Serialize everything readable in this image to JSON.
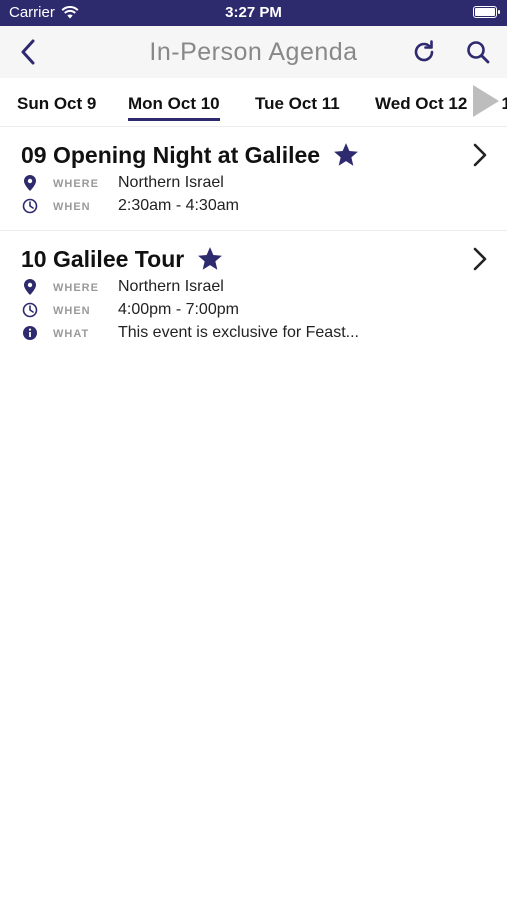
{
  "status_bar": {
    "carrier": "Carrier",
    "time": "3:27 PM"
  },
  "nav": {
    "title": "In-Person Agenda",
    "back_icon": "chevron-left-icon",
    "refresh_icon": "refresh-icon",
    "search_icon": "search-icon"
  },
  "tabs": [
    {
      "label": "Sun Oct 9"
    },
    {
      "label": "Mon Oct 10",
      "active": true
    },
    {
      "label": "Tue Oct 11"
    },
    {
      "label": "Wed Oct 12"
    },
    {
      "label": "1"
    }
  ],
  "events": [
    {
      "title": "09 Opening Night at Galilee",
      "favorited": true,
      "where_label": "WHERE",
      "where": "Northern Israel",
      "when_label": "WHEN",
      "when": "2:30am - 4:30am"
    },
    {
      "title": "10 Galilee Tour",
      "favorited": true,
      "where_label": "WHERE",
      "where": "Northern Israel",
      "when_label": "WHEN",
      "when": "4:00pm - 7:00pm",
      "what_label": "WHAT",
      "what": "This event is exclusive for Feast..."
    }
  ],
  "colors": {
    "accent": "#2e2a6e",
    "muted": "#9a9a9a"
  }
}
